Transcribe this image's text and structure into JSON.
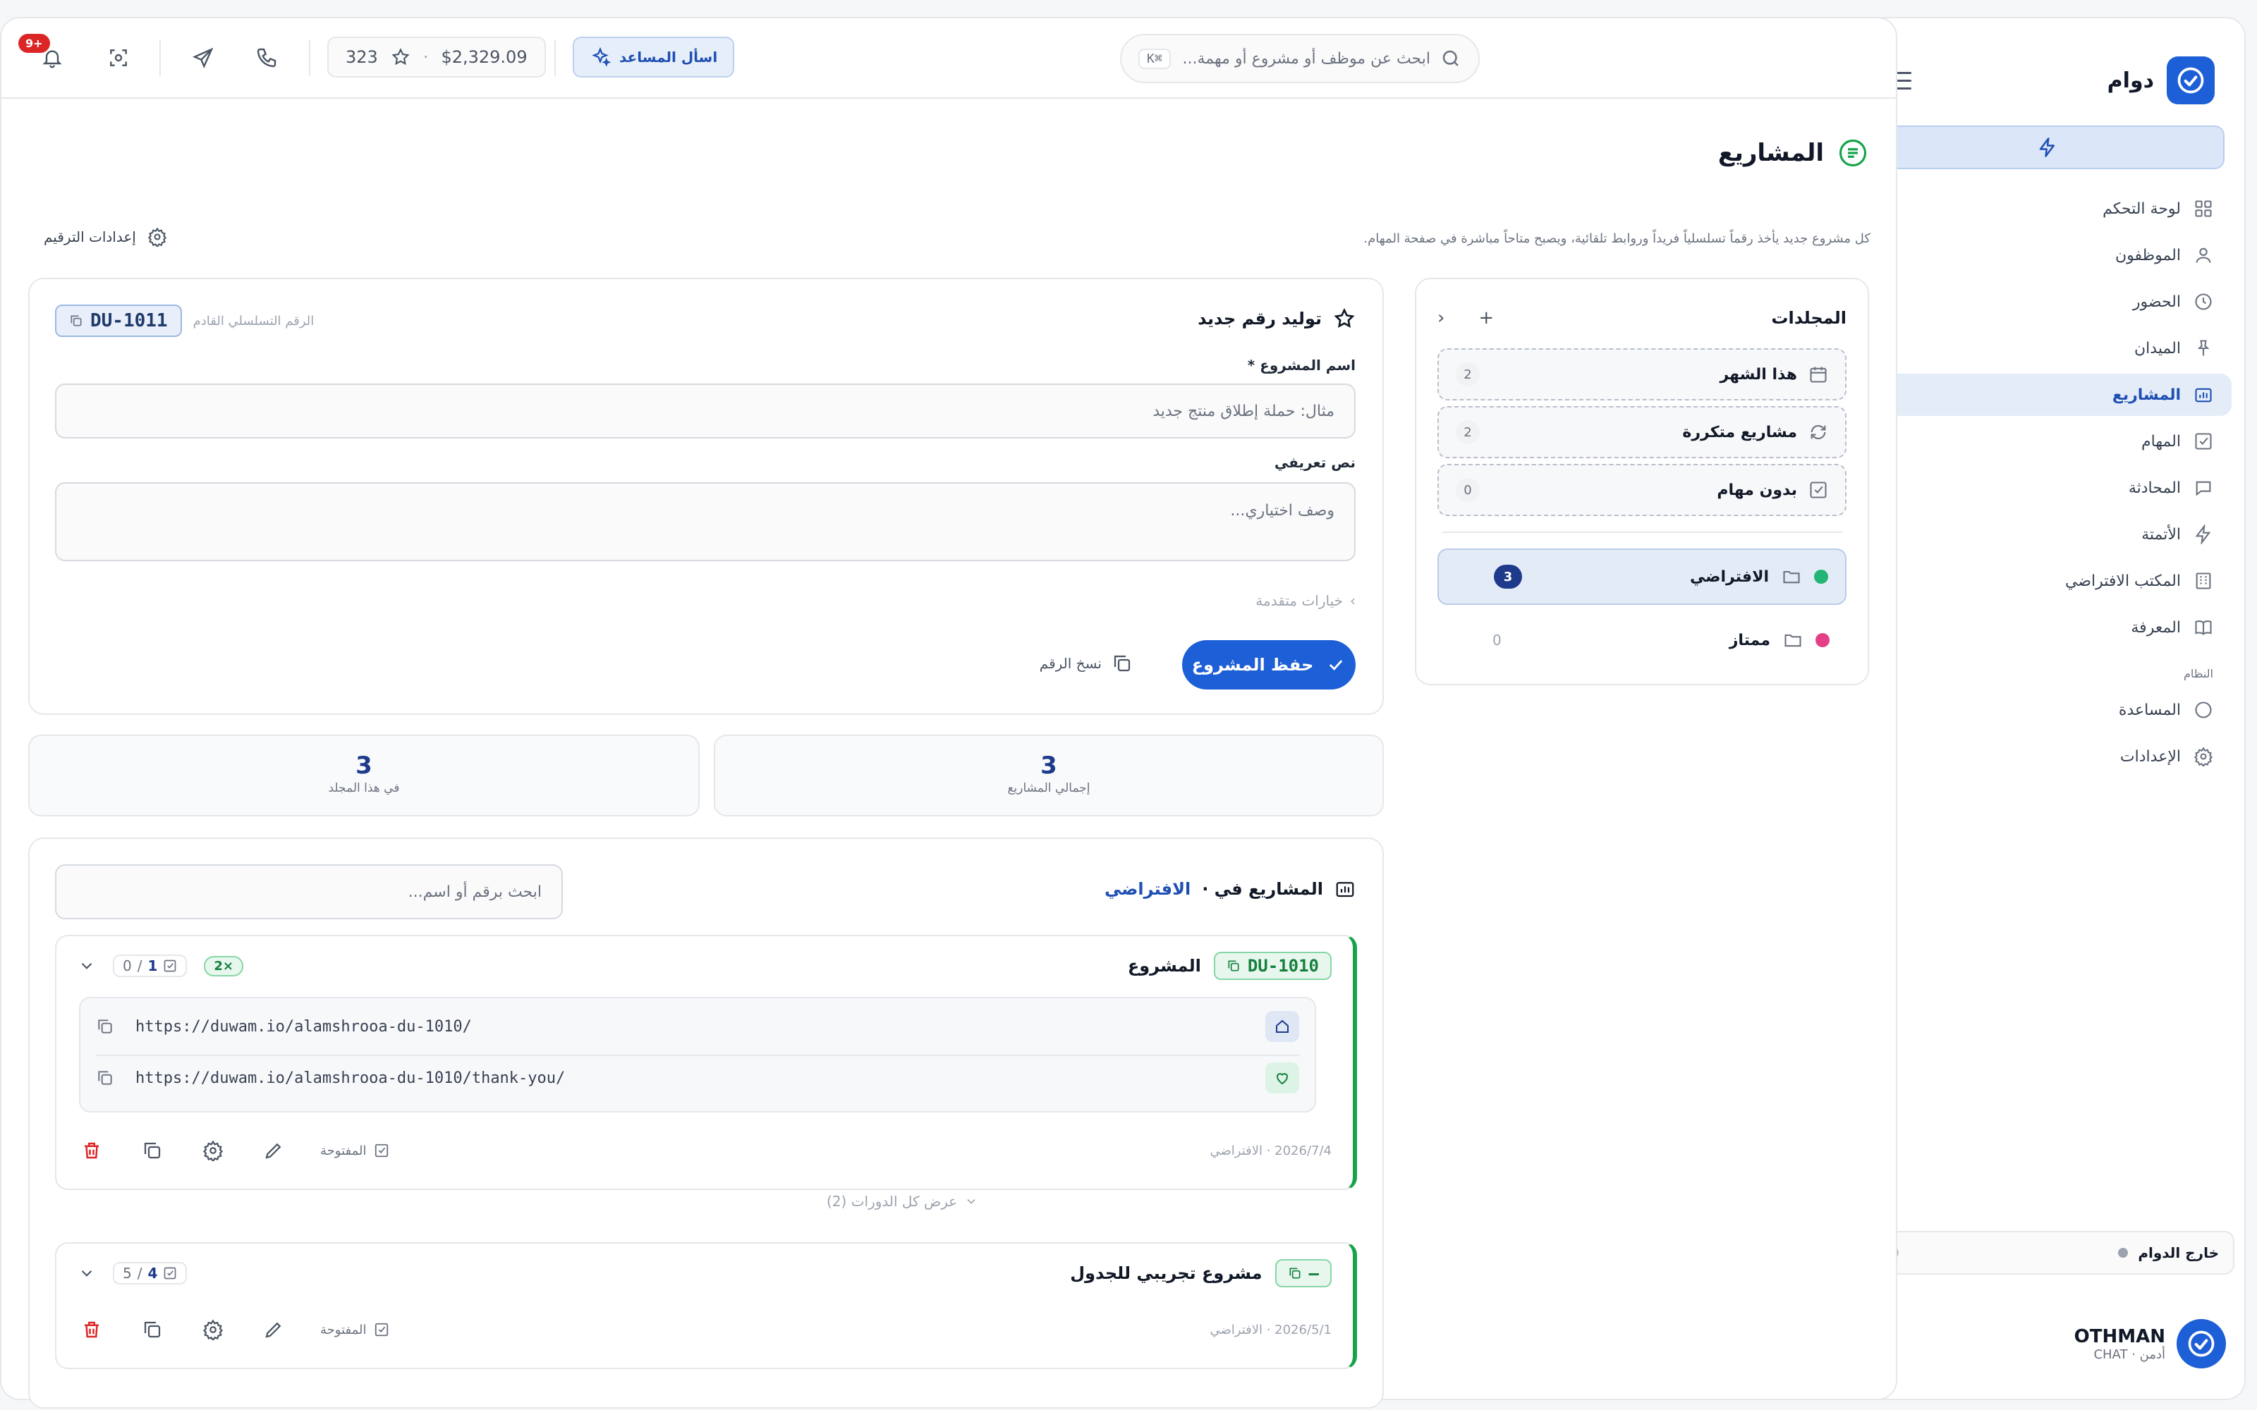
{
  "app": {
    "brand_name": "دوام",
    "colors": {
      "primary": "#1d5fd6",
      "accent_green": "#16a34a",
      "danger": "#dc2626",
      "pink": "#e43f87",
      "teal": "#22b573"
    }
  },
  "sidebar": {
    "items": [
      {
        "label": "لوحة التحكم",
        "icon": "grid-icon"
      },
      {
        "label": "الموظفون",
        "icon": "user-icon"
      },
      {
        "label": "الحضور",
        "icon": "clock-icon"
      },
      {
        "label": "الميدان",
        "icon": "pin-icon"
      },
      {
        "label": "المشاريع",
        "icon": "folder-chart-icon",
        "active": true
      },
      {
        "label": "المهام",
        "icon": "check-square-icon"
      },
      {
        "label": "المحادثة",
        "icon": "chat-icon"
      },
      {
        "label": "الأتمتة",
        "icon": "bolt-icon"
      },
      {
        "label": "المكتب الافتراضي",
        "icon": "building-icon"
      },
      {
        "label": "المعرفة",
        "icon": "book-icon"
      }
    ],
    "section_system": "النظام",
    "system_items": [
      {
        "label": "المساعدة",
        "icon": "help-circle-icon"
      },
      {
        "label": "الإعدادات",
        "icon": "gear-icon"
      }
    ],
    "status": "خارج الدوام",
    "user": {
      "name": "OTHMAN",
      "sub": "أدمن · CHAT"
    }
  },
  "topbar": {
    "search_placeholder": "ابحث عن موظف أو مشروع أو مهمة...",
    "shortcut": "⌘K",
    "assistant_label": "اسأل المساعد",
    "balance": "$2,329.09",
    "points": "323",
    "notifications": "+9"
  },
  "page": {
    "title": "المشاريع",
    "description": "كل مشروع جديد يأخذ رقماً تسلسلياً فريداً وروابط تلقائية، ويصبح متاحاً مباشرة في صفحة المهام.",
    "numbering_settings": "إعدادات الترقيم"
  },
  "folders": {
    "title": "المجلدات",
    "smart": [
      {
        "label": "هذا الشهر",
        "count": "2"
      },
      {
        "label": "مشاريع متكررة",
        "count": "2"
      },
      {
        "label": "بدون مهام",
        "count": "0"
      }
    ],
    "list": [
      {
        "label": "الافتراضي",
        "count": "3",
        "color": "#22b573",
        "active": true
      },
      {
        "label": "ممتاز",
        "count": "0",
        "color": "#e43f87"
      }
    ]
  },
  "generator": {
    "title": "توليد رقم جديد",
    "old_serial_label": "الرقم التسلسلي القادم",
    "serial": "DU-1011",
    "name_label": "اسم المشروع *",
    "name_placeholder": "مثال: حملة إطلاق منتج جديد",
    "desc_label": "نص تعريفي",
    "desc_placeholder": "وصف اختياري...",
    "advanced": "خيارات متقدمة",
    "save": "حفظ المشروع",
    "copy_number": "نسخ الرقم"
  },
  "stats": {
    "total_value": "3",
    "total_label": "إجمالي المشاريع",
    "folder_value": "3",
    "folder_label": "في هذا المجلد"
  },
  "projects": {
    "heading_prefix": "المشاريع في ·",
    "heading_folder": "الافتراضي",
    "search_placeholder": "ابحث برقم أو اسم...",
    "show_all": "عرض كل الدورات (2)",
    "items": [
      {
        "serial": "DU-1010",
        "name": "المشروع",
        "repeat": "2×",
        "done": "1",
        "total": "0",
        "links": [
          "https://duwam.io/alamshrooa-du-1010/",
          "https://duwam.io/alamshrooa-du-1010/thank-you/"
        ],
        "date": "2026/7/4 · الافتراضي",
        "status": "المفتوحة"
      },
      {
        "serial": "—",
        "name": "مشروع تجريبي للجدول",
        "done": "4",
        "total": "5",
        "date": "2026/5/1 · الافتراضي",
        "status": "المفتوحة"
      }
    ]
  }
}
